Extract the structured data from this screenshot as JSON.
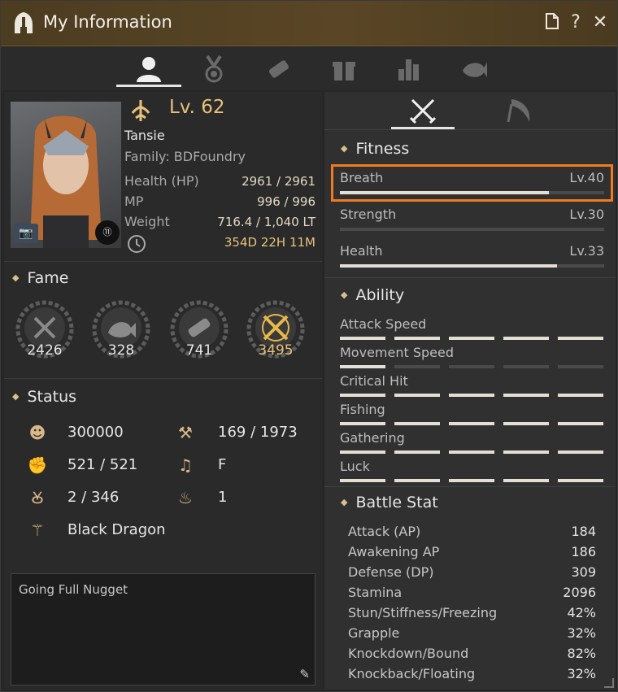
{
  "window": {
    "title": "My Information",
    "title_icon": "helmet-icon",
    "buttons": [
      "document-icon",
      "help-icon",
      "close-icon"
    ],
    "accent_color": "#e8c27a",
    "highlight_color": "#f07a1f"
  },
  "tabs": [
    {
      "name": "profile",
      "icon": "person-icon",
      "active": true
    },
    {
      "name": "medal",
      "icon": "medal-icon",
      "active": false
    },
    {
      "name": "scroll",
      "icon": "scroll-icon",
      "active": false
    },
    {
      "name": "gift",
      "icon": "gift-icon",
      "active": false
    },
    {
      "name": "stats",
      "icon": "bar-chart-icon",
      "active": false
    },
    {
      "name": "fish",
      "icon": "fish-icon",
      "active": false
    }
  ],
  "profile": {
    "level": "Lv. 62",
    "name": "Tansie",
    "family": "Family: BDFoundry",
    "hp_label": "Health (HP)",
    "hp_value": "2961 / 2961",
    "mp_label": "MP",
    "mp_value": "996 / 996",
    "weight_label": "Weight",
    "weight_value": "716.4 / 1,040 LT",
    "time_value": "354D 22H 11M"
  },
  "fame": {
    "header": "Fame",
    "items": [
      {
        "icon": "swords-icon",
        "value": "2426"
      },
      {
        "icon": "fish-icon",
        "value": "328"
      },
      {
        "icon": "scroll-icon",
        "value": "741"
      },
      {
        "icon": "crossed-swords-gold-icon",
        "value": "3495"
      }
    ]
  },
  "status": {
    "header": "Status",
    "rows": [
      {
        "icon": "head-icon",
        "value": "300000"
      },
      {
        "icon": "axe-icon",
        "value": "169 / 1973"
      },
      {
        "icon": "arm-icon",
        "value": "521 / 521"
      },
      {
        "icon": "music-icon",
        "value": "F"
      },
      {
        "icon": "horseshoe-icon",
        "value": "2 / 346"
      },
      {
        "icon": "flame-icon",
        "value": "1"
      },
      {
        "icon": "dragon-icon",
        "value": "Black Dragon"
      }
    ]
  },
  "memo": {
    "text": "Going Full Nugget"
  },
  "right_tabs": [
    {
      "icon": "crossed-swords-icon",
      "active": true
    },
    {
      "icon": "sickle-icon",
      "active": false
    }
  ],
  "fitness": {
    "header": "Fitness",
    "items": [
      {
        "name": "Breath",
        "level": "Lv.40",
        "progress": 0.79
      },
      {
        "name": "Strength",
        "level": "Lv.30",
        "progress": 0.0
      },
      {
        "name": "Health",
        "level": "Lv.33",
        "progress": 0.82
      }
    ]
  },
  "ability": {
    "header": "Ability",
    "items": [
      {
        "name": "Attack Speed",
        "filled": 5
      },
      {
        "name": "Movement Speed",
        "filled": 1
      },
      {
        "name": "Critical Hit",
        "filled": 5
      },
      {
        "name": "Fishing",
        "filled": 5
      },
      {
        "name": "Gathering",
        "filled": 5
      },
      {
        "name": "Luck",
        "filled": 5
      }
    ]
  },
  "battle": {
    "header": "Battle Stat",
    "items": [
      {
        "name": "Attack (AP)",
        "value": "184"
      },
      {
        "name": "Awakening AP",
        "value": "186"
      },
      {
        "name": "Defense (DP)",
        "value": "309"
      },
      {
        "name": "Stamina",
        "value": "2096"
      },
      {
        "name": "Stun/Stiffness/Freezing",
        "value": "42%"
      },
      {
        "name": "Grapple",
        "value": "32%"
      },
      {
        "name": "Knockdown/Bound",
        "value": "82%"
      },
      {
        "name": "Knockback/Floating",
        "value": "32%"
      }
    ]
  }
}
